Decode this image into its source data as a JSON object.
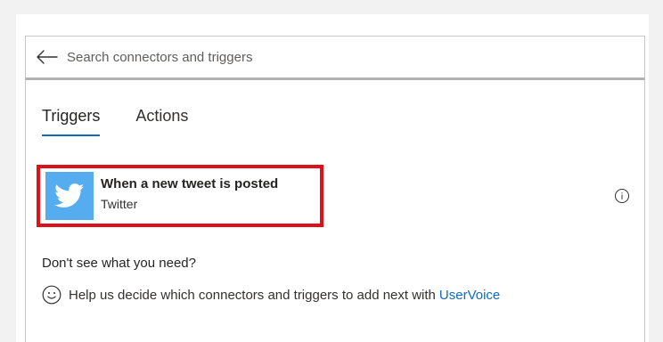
{
  "search": {
    "placeholder": "Search connectors and triggers"
  },
  "tabs": [
    {
      "label": "Triggers",
      "active": true
    },
    {
      "label": "Actions",
      "active": false
    }
  ],
  "trigger": {
    "title": "When a new tweet is posted",
    "connector": "Twitter",
    "icon": "twitter-bird-icon",
    "tile_color": "#55acee"
  },
  "highlight_color": "#e0101a",
  "help": {
    "question": "Don't see what you need?",
    "text": "Help us decide which connectors and triggers to add next with",
    "link_label": "UserVoice"
  },
  "colors": {
    "accent": "#0f6cbd"
  }
}
